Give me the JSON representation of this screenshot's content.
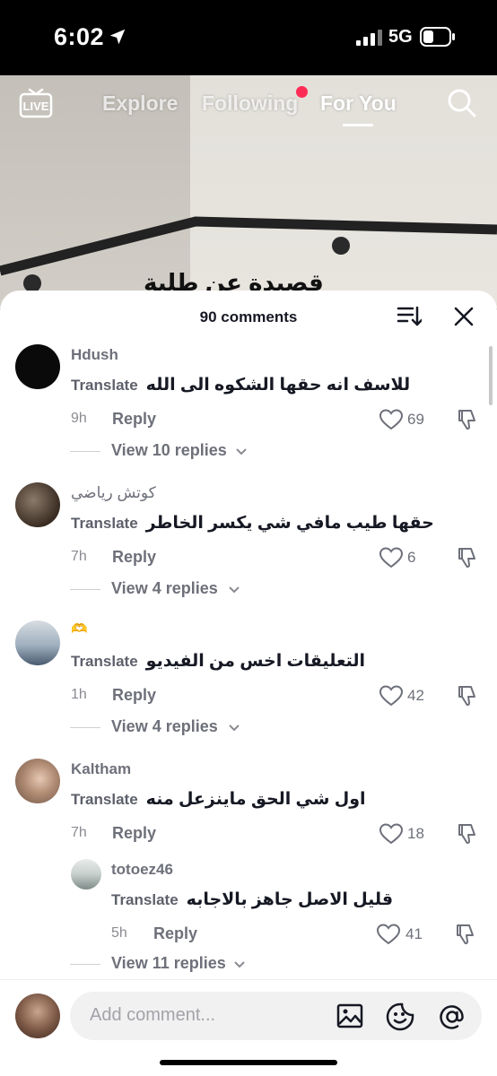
{
  "status_bar": {
    "time": "6:02",
    "network": "5G"
  },
  "top_nav": {
    "live_label": "LIVE",
    "tabs": [
      {
        "label": "Explore"
      },
      {
        "label": "Following"
      },
      {
        "label": "For You"
      }
    ],
    "active_tab": "For You"
  },
  "video": {
    "caption_partial": "قصيدة عن طلبة"
  },
  "sheet": {
    "title": "90 comments",
    "comments": [
      {
        "username": "Hdush",
        "translate": "Translate",
        "text": "للاسف انه حقها الشكوه الى الله",
        "time": "9h",
        "reply": "Reply",
        "likes": "69",
        "view_replies": "View 10 replies"
      },
      {
        "username": "كوتش رياضي",
        "translate": "Translate",
        "text": "حقها طيب مافي شي يكسر الخاطر",
        "time": "7h",
        "reply": "Reply",
        "likes": "6",
        "view_replies": "View 4 replies"
      },
      {
        "username": "🫶",
        "translate": "Translate",
        "text": "التعليقات اخس من الفيديو",
        "time": "1h",
        "reply": "Reply",
        "likes": "42",
        "view_replies": "View 4 replies"
      },
      {
        "username": "Kaltham",
        "translate": "Translate",
        "text": "اول شي الحق ماينزعل منه",
        "time": "7h",
        "reply": "Reply",
        "likes": "18"
      }
    ],
    "reply_comment": {
      "username": "totoez46",
      "translate": "Translate",
      "text": "قليل الاصل جاهز بالاجابه",
      "time": "5h",
      "reply": "Reply",
      "likes": "41",
      "view_replies": "View 11 replies"
    }
  },
  "bottom": {
    "placeholder": "Add comment..."
  },
  "colors": {
    "accent": "#fe2c55",
    "text": "#161823",
    "muted": "#6e707a"
  }
}
